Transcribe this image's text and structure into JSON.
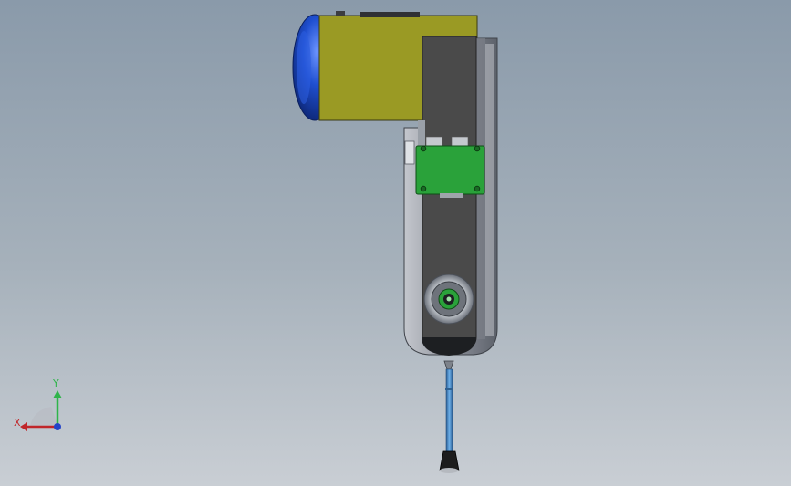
{
  "triad": {
    "x_label": "X",
    "y_label": "Y",
    "x_color": "#c0262a",
    "y_color": "#2fb44a",
    "z_color": "#2444c8"
  },
  "model": {
    "colors": {
      "motor_housing": "#9a9a24",
      "motor_cap": "#1f4fd0",
      "arm_dark": "#4a4a4a",
      "arm_frame": "#8e929c",
      "mount_plate": "#2aa23a",
      "probe_rod": "#5b9ad6"
    }
  }
}
